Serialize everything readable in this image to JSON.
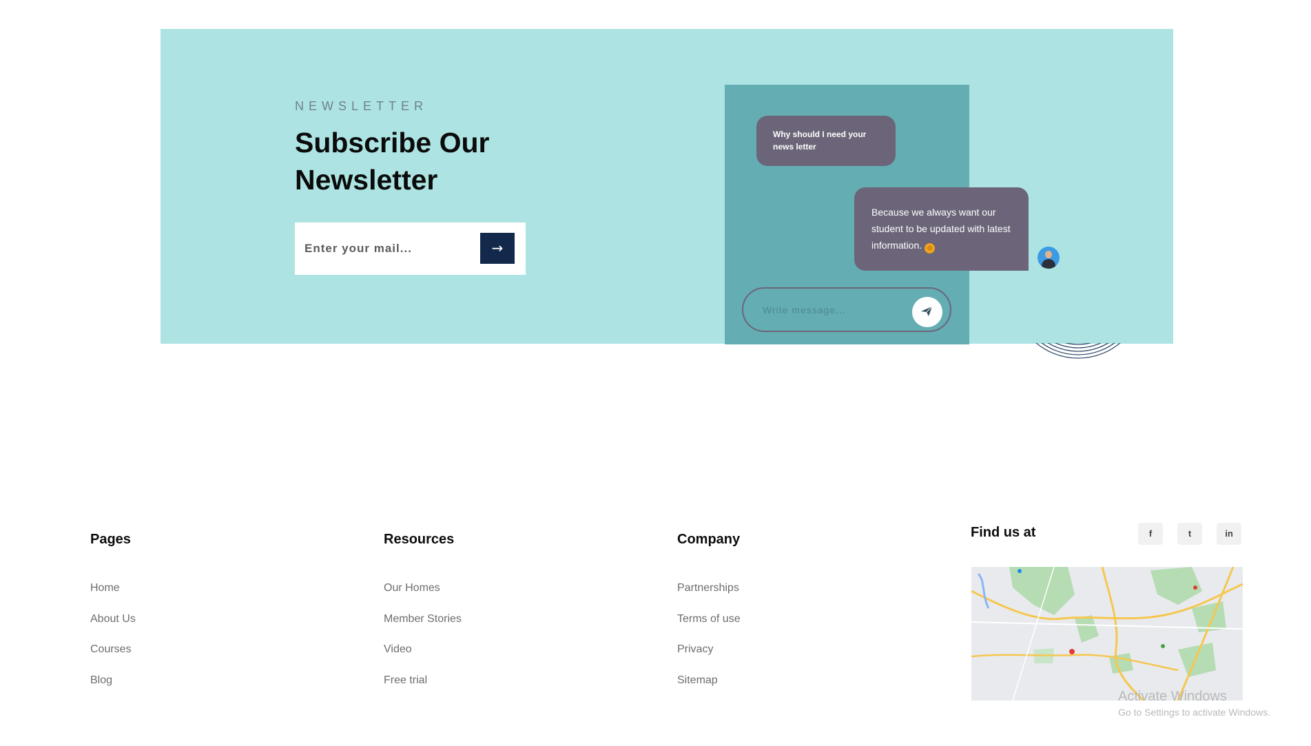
{
  "newsletter": {
    "eyebrow": "NEWSLETTER",
    "title": "Subscribe Our Newsletter",
    "email_placeholder": "Enter your mail...",
    "submit_icon": "arrow-right-icon",
    "submit_glyph": "→"
  },
  "chat": {
    "question": "Why should I need your news letter",
    "answer": "Because we always want our student to be updated with latest information.",
    "emoji": "smiling-face-icon",
    "message_placeholder": "Write message...",
    "send_icon": "paper-plane-icon"
  },
  "footer": {
    "columns": [
      {
        "title": "Pages",
        "links": [
          "Home",
          "About Us",
          "Courses",
          "Blog"
        ]
      },
      {
        "title": "Resources",
        "links": [
          "Our Homes",
          "Member Stories",
          "Video",
          "Free trial"
        ]
      },
      {
        "title": "Company",
        "links": [
          "Partnerships",
          "Terms of use",
          "Privacy",
          "Sitemap"
        ]
      }
    ],
    "find_us": {
      "title": "Find us at",
      "social": [
        {
          "icon": "facebook-icon",
          "glyph": "f"
        },
        {
          "icon": "twitter-icon",
          "glyph": "t"
        },
        {
          "icon": "linkedin-icon",
          "glyph": "in"
        }
      ]
    }
  },
  "os_overlay": {
    "title": "Activate Windows",
    "subtitle": "Go to Settings to activate Windows."
  },
  "colors": {
    "band": "#ade4e3",
    "chat_panel": "#63adb3",
    "bubble": "#6c6579",
    "submit": "#13294b"
  }
}
